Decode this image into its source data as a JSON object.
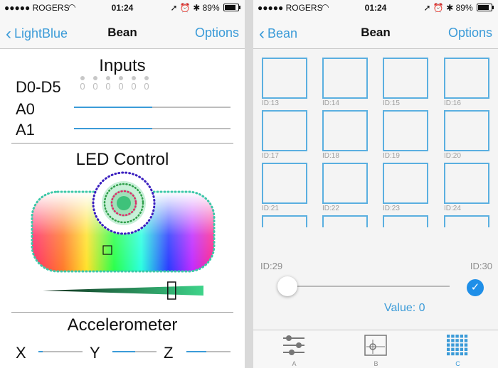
{
  "left": {
    "status": {
      "carrier": "●●●●● ROGERS",
      "time": "01:24",
      "battery": "89%"
    },
    "nav": {
      "back": "LightBlue",
      "title": "Bean",
      "options": "Options"
    },
    "inputs": {
      "title": "Inputs",
      "digital_label": "D0-D5",
      "pins": [
        "0",
        "0",
        "0",
        "0",
        "0",
        "0"
      ],
      "a0_label": "A0",
      "a0_value": 0.5,
      "a1_label": "A1",
      "a1_value": 0.5
    },
    "led": {
      "title": "LED Control",
      "brightness": 0.8
    },
    "accel": {
      "title": "Accelerometer",
      "x_label": "X",
      "y_label": "Y",
      "z_label": "Z"
    }
  },
  "right": {
    "status": {
      "carrier": "●●●●● ROGERS",
      "time": "01:24",
      "battery": "89%"
    },
    "nav": {
      "back": "Bean",
      "title": "Bean",
      "options": "Options"
    },
    "grid_ids": [
      "ID:13",
      "ID:14",
      "ID:15",
      "ID:16",
      "ID:17",
      "ID:18",
      "ID:19",
      "ID:20",
      "ID:21",
      "ID:22",
      "ID:23",
      "ID:24"
    ],
    "slider": {
      "left_id": "ID:29",
      "right_id": "ID:30",
      "value_text": "Value: 0",
      "value": 0
    },
    "tabs": [
      "A",
      "B",
      "C"
    ],
    "accent": "#3b9bd8"
  }
}
